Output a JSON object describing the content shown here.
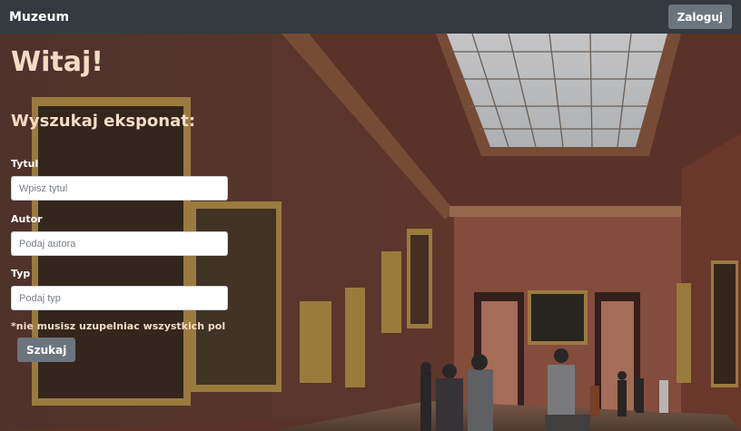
{
  "navbar": {
    "brand": "Muzeum",
    "login_label": "Zaloguj"
  },
  "main": {
    "welcome": "Witaj!",
    "search_heading": "Wyszukaj eksponat:",
    "fields": {
      "title": {
        "label": "Tytul",
        "placeholder": "Wpisz tytul",
        "value": ""
      },
      "author": {
        "label": "Autor",
        "placeholder": "Podaj autora",
        "value": ""
      },
      "type": {
        "label": "Typ",
        "placeholder": "Podaj typ",
        "value": ""
      }
    },
    "note": "*nie musisz uzupelniac wszystkich pol",
    "search_label": "Szukaj"
  },
  "colors": {
    "navbar_bg": "#343a40",
    "button_bg": "#6c757d",
    "heading_text": "#f3dcc4"
  }
}
